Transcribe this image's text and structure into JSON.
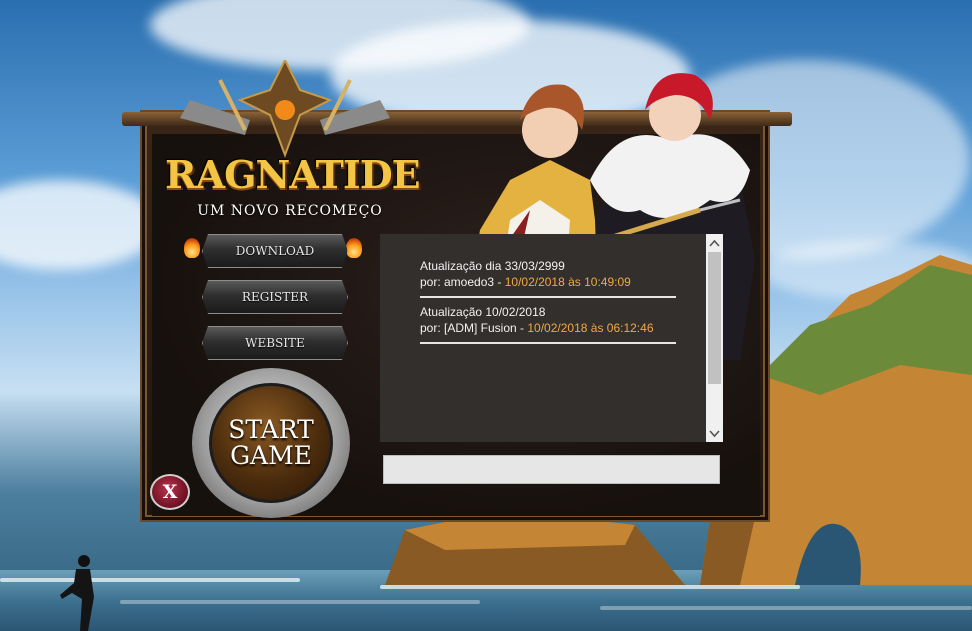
{
  "launcher": {
    "logo_title": "RAGNATIDE",
    "logo_subtitle": "UM NOVO RECOMEÇO",
    "buttons": {
      "download": "DOWNLOAD",
      "register": "REGISTER",
      "website": "WEBSITE"
    },
    "start": {
      "line1": "START",
      "line2": "GAME"
    },
    "close_label": "X"
  },
  "news": [
    {
      "title": "Atualização dia 33/03/2999",
      "author_prefix": "por: amoedo3 - ",
      "date": "10/02/2018 às 10:49:09"
    },
    {
      "title": "Atualização 10/02/2018",
      "author_prefix": "por: [ADM] Fusion - ",
      "date": "10/02/2018 às 06:12:46"
    }
  ],
  "scroll": {
    "up_icon": "chevron-up-icon",
    "down_icon": "chevron-down-icon"
  },
  "colors": {
    "accent_orange": "#f0a944",
    "logo_gold": "#f3c545",
    "panel": "#332f2d"
  }
}
